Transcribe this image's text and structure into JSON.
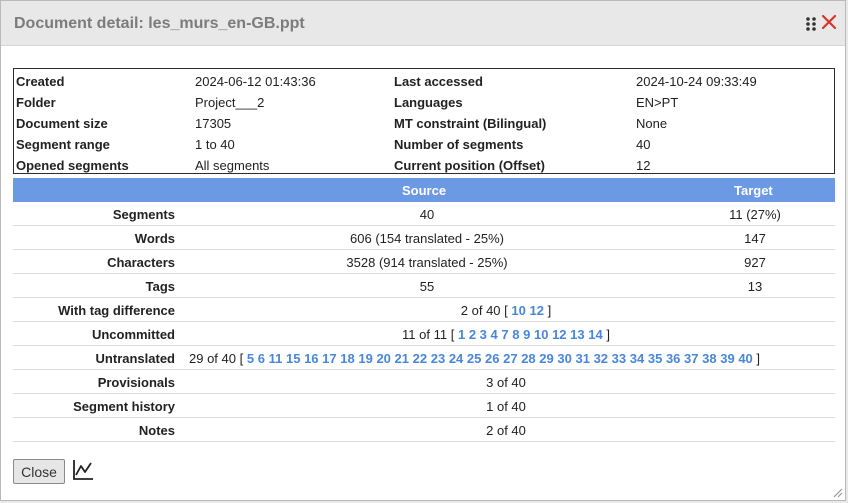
{
  "dialog": {
    "title": "Document detail: les_murs_en-GB.ppt"
  },
  "info": [
    {
      "k1": "Created",
      "v1": "2024-06-12 01:43:36",
      "k2": "Last accessed",
      "v2": "2024-10-24 09:33:49"
    },
    {
      "k1": "Folder",
      "v1": "Project___2",
      "k2": "Languages",
      "v2": "EN>PT"
    },
    {
      "k1": "Document size",
      "v1": "17305",
      "k2": "MT constraint (Bilingual)",
      "v2": "None"
    },
    {
      "k1": "Segment range",
      "v1": "1 to 40",
      "k2": "Number of segments",
      "v2": "40"
    },
    {
      "k1": "Opened segments",
      "v1": "All segments",
      "k2": "Current position (Offset)",
      "v2": "12"
    }
  ],
  "stats": {
    "source_header": "Source",
    "target_header": "Target",
    "segments": {
      "label": "Segments",
      "source": "40",
      "target": "11 (27%)"
    },
    "words": {
      "label": "Words",
      "source": "606 (154 translated - 25%)",
      "target": "147"
    },
    "characters": {
      "label": "Characters",
      "source": "3528 (914 translated - 25%)",
      "target": "927"
    },
    "tags": {
      "label": "Tags",
      "source": "55",
      "target": "13"
    },
    "tag_diff": {
      "label": "With tag difference",
      "count": "2 of 40",
      "open": "[",
      "close": "]",
      "links": [
        "10",
        "12"
      ]
    },
    "uncommitted": {
      "label": "Uncommitted",
      "count": "11 of 11",
      "open": "[",
      "close": "]",
      "links": [
        "1",
        "2",
        "3",
        "4",
        "7",
        "8",
        "9",
        "10",
        "12",
        "13",
        "14"
      ]
    },
    "untranslated": {
      "label": "Untranslated",
      "count": "29 of 40",
      "open": "[",
      "close": "]",
      "links": [
        "5",
        "6",
        "11",
        "15",
        "16",
        "17",
        "18",
        "19",
        "20",
        "21",
        "22",
        "23",
        "24",
        "25",
        "26",
        "27",
        "28",
        "29",
        "30",
        "31",
        "32",
        "33",
        "34",
        "35",
        "36",
        "37",
        "38",
        "39",
        "40"
      ]
    },
    "provisionals": {
      "label": "Provisionals",
      "value": "3 of 40"
    },
    "history": {
      "label": "Segment history",
      "value": "1 of 40"
    },
    "notes": {
      "label": "Notes",
      "value": "2 of 40"
    }
  },
  "footer": {
    "close_label": "Close"
  },
  "icons": {
    "grip": "drag-grip-icon",
    "close": "close-icon",
    "chart": "chart-icon",
    "resize": "resize-grip-icon"
  },
  "colors": {
    "header_bg": "#6c99e3",
    "link": "#4a86d9",
    "close_x": "#d9342b"
  }
}
